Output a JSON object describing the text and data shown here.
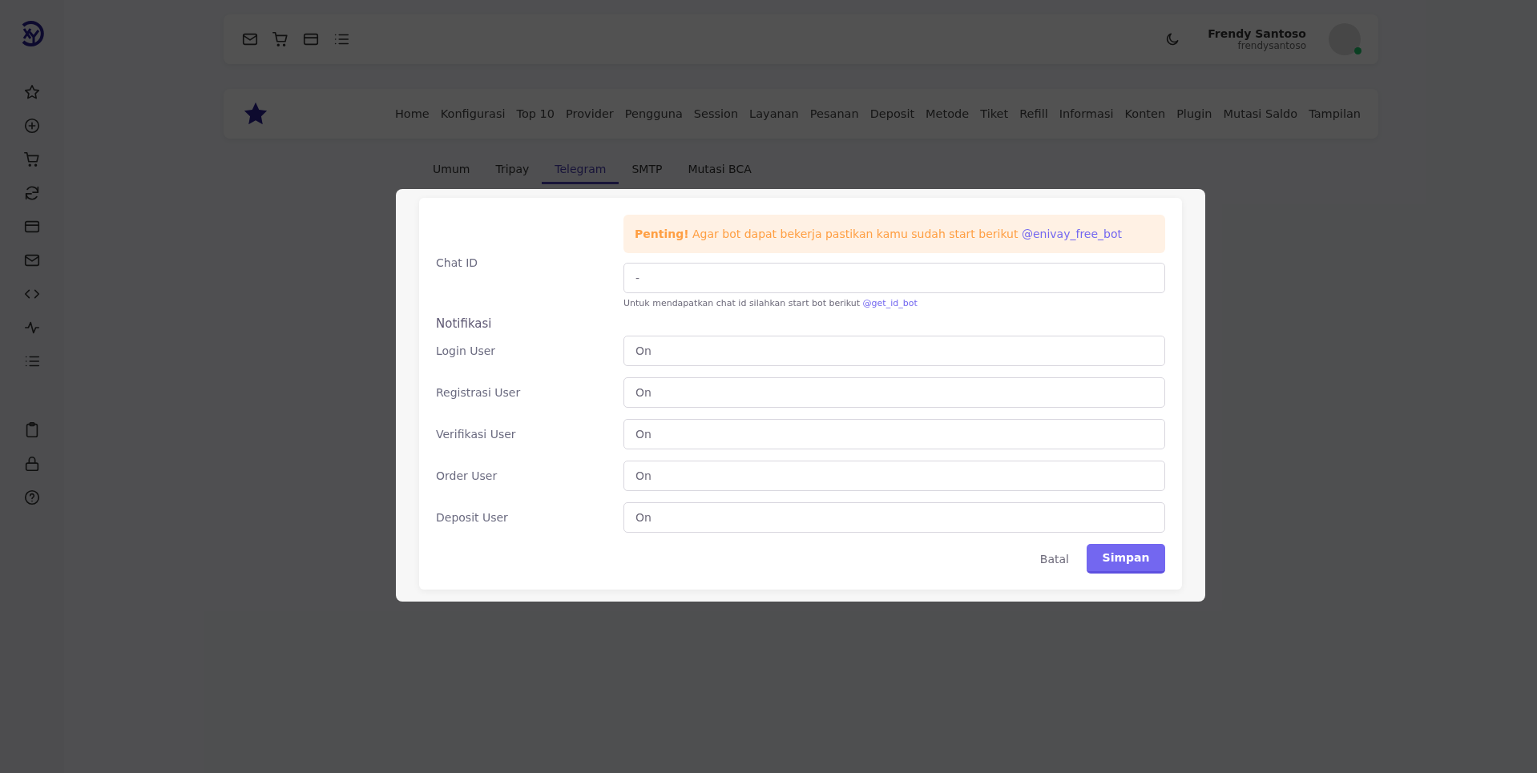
{
  "user": {
    "name": "Frendy Santoso",
    "username": "frendysantoso",
    "online": true
  },
  "nav": {
    "items": [
      "Home",
      "Konfigurasi",
      "Top 10",
      "Provider",
      "Pengguna",
      "Session",
      "Layanan",
      "Pesanan",
      "Deposit",
      "Metode",
      "Tiket",
      "Refill",
      "Informasi",
      "Konten",
      "Plugin",
      "Mutasi Saldo",
      "Tampilan"
    ]
  },
  "tabs": [
    {
      "label": "Umum",
      "selected": false
    },
    {
      "label": "Tripay",
      "selected": false
    },
    {
      "label": "Telegram",
      "selected": true
    },
    {
      "label": "SMTP",
      "selected": false
    },
    {
      "label": "Mutasi BCA",
      "selected": false
    }
  ],
  "modal": {
    "alert": {
      "text": "**Penting!** Agar bot dapat bekerja pastikan kamu sudah start berikut",
      "link": "@enivay_free_bot"
    },
    "chat_id": {
      "label": "Chat ID",
      "value": "-",
      "help": "Untuk mendapatkan chat id silahkan start bot berikut",
      "help_link": "@get_id_bot"
    },
    "section": "Notifikasi",
    "fields": [
      {
        "label": "Login User",
        "value": "On"
      },
      {
        "label": "Registrasi User",
        "value": "On"
      },
      {
        "label": "Verifikasi User",
        "value": "On"
      },
      {
        "label": "Order User",
        "value": "On"
      },
      {
        "label": "Deposit User",
        "value": "On"
      }
    ],
    "cancel": "Batal",
    "save": "Simpan"
  }
}
